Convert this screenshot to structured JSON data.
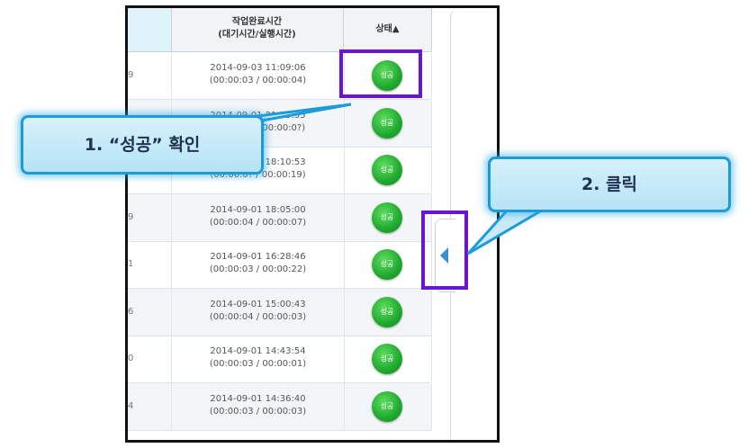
{
  "table": {
    "header": {
      "time_line1": "작업완료시간",
      "time_line2": "(대기시간/실행시간)",
      "status": "상태▲"
    },
    "rows": [
      {
        "num": "9",
        "completed": "2014-09-03 11:09:06",
        "durations": "(00:00:03 / 00:00:04)",
        "status": "성공"
      },
      {
        "num": "",
        "completed": "2014-09-01 21:15:55",
        "durations": "(00:00:0? / 00:00:0?)",
        "status": "성공"
      },
      {
        "num": "",
        "completed": "2014-09-01 18:10:53",
        "durations": "(00:00:0? / 00:00:19)",
        "status": "성공"
      },
      {
        "num": "9",
        "completed": "2014-09-01 18:05:00",
        "durations": "(00:00:04 / 00:00:07)",
        "status": "성공"
      },
      {
        "num": "1",
        "completed": "2014-09-01 16:28:46",
        "durations": "(00:00:03 / 00:00:22)",
        "status": "성공"
      },
      {
        "num": "6",
        "completed": "2014-09-01 15:00:43",
        "durations": "(00:00:04 / 00:00:03)",
        "status": "성공"
      },
      {
        "num": "0",
        "completed": "2014-09-01 14:43:54",
        "durations": "(00:00:03 / 00:00:01)",
        "status": "성공"
      },
      {
        "num": "4",
        "completed": "2014-09-01 14:36:40",
        "durations": "(00:00:03 / 00:00:03)",
        "status": "성공"
      }
    ]
  },
  "callouts": {
    "step1": "1. “성공” 확인",
    "step2": "2. 클릭"
  },
  "colors": {
    "highlight": "#6a14d6",
    "callout_border": "#1c9bd8",
    "success_badge": "#1fa92f",
    "toggle_arrow": "#3a8fd4"
  },
  "icons": {
    "toggle": "triangle-left-icon"
  }
}
